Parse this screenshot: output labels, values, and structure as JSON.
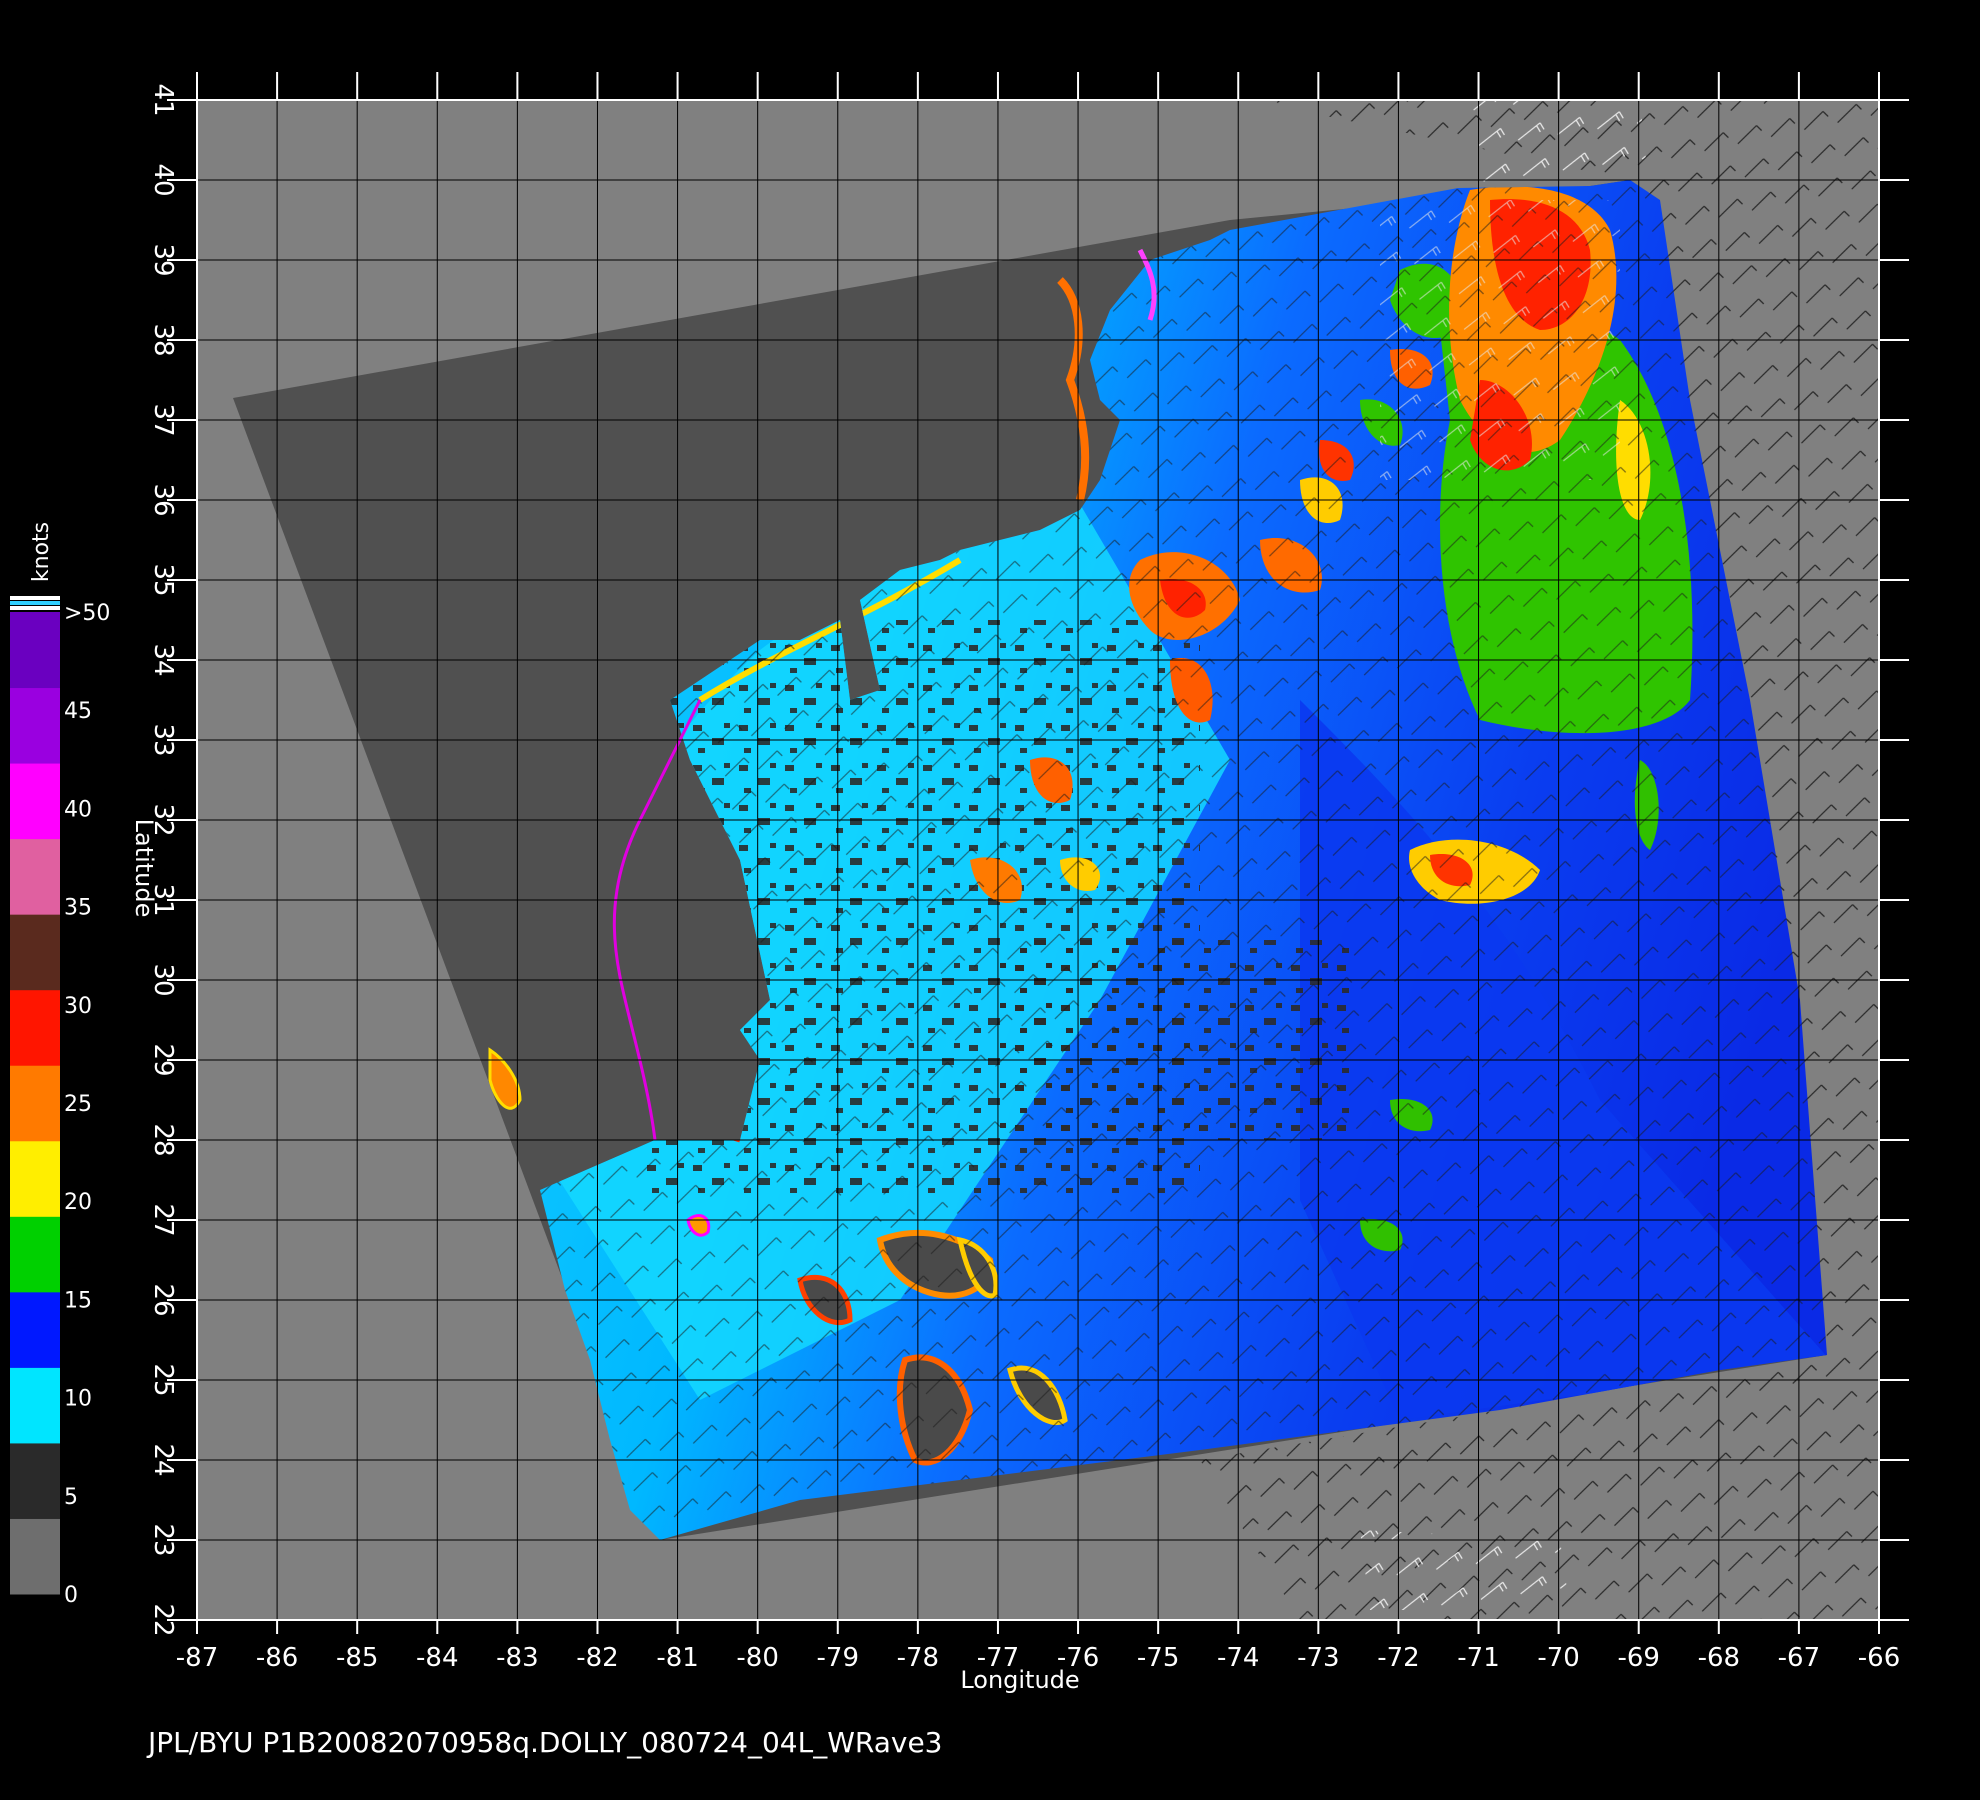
{
  "footer_text": "JPL/BYU  P1B20082070958q.DOLLY_080724_04L_WRave3",
  "axes": {
    "x_title": "Longitude",
    "y_title": "Latitude",
    "x_ticks": [
      "-87",
      "-86",
      "-85",
      "-84",
      "-83",
      "-82",
      "-81",
      "-80",
      "-79",
      "-78",
      "-77",
      "-76",
      "-75",
      "-74",
      "-73",
      "-72",
      "-71",
      "-70",
      "-69",
      "-68",
      "-67",
      "-66"
    ],
    "y_ticks": [
      "22",
      "23",
      "24",
      "25",
      "26",
      "27",
      "28",
      "29",
      "30",
      "31",
      "32",
      "33",
      "34",
      "35",
      "36",
      "37",
      "38",
      "39",
      "40",
      "41"
    ],
    "x_range": [
      -87,
      -66
    ],
    "y_range": [
      22,
      41
    ]
  },
  "legend": {
    "title": "knots",
    "labels": [
      "0",
      "5",
      "10",
      "15",
      "20",
      "25",
      "30",
      "35",
      "40",
      "45",
      ">50"
    ],
    "colors": [
      "#6e6e6e",
      "#2a2a2a",
      "#00e5ff",
      "#0018ff",
      "#00d000",
      "#ffee00",
      "#ff7a00",
      "#ff1500",
      "#5a2a1e",
      "#e060a0",
      "#ff00ff",
      "#9a00e0",
      "#6a00c0"
    ]
  },
  "map": {
    "background_color": "#808080",
    "swath_land_color": "#505050",
    "ocean_low_color": "#00c8ff",
    "ocean_mid_color": "#0060ff",
    "wind_high_color": "#ff2a00",
    "wind_moderate_color": "#30c000",
    "storm": "DOLLY"
  }
}
